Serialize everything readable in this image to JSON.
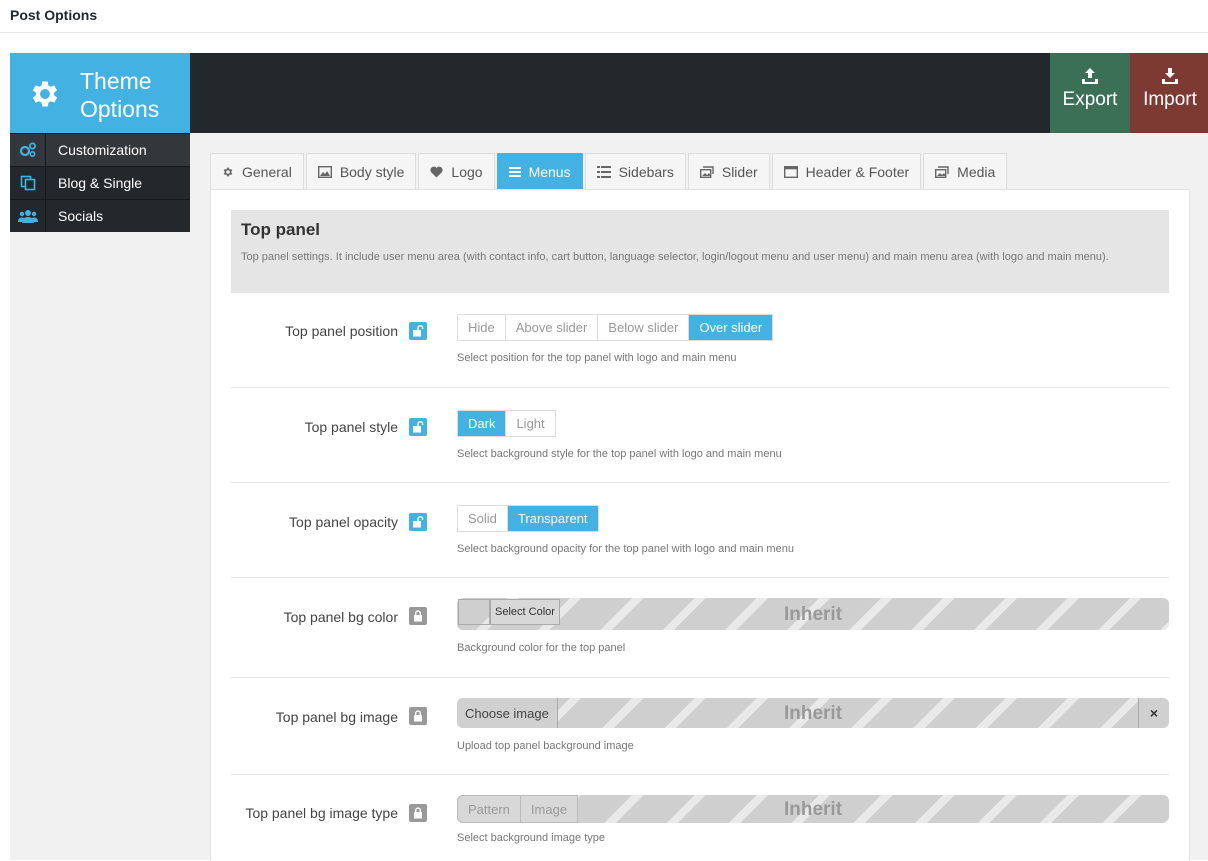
{
  "page": {
    "title": "Post Options"
  },
  "brand": {
    "line1": "Theme",
    "line2": "Options"
  },
  "actions": {
    "export_label": "Export",
    "import_label": "Import"
  },
  "sidebar": {
    "items": [
      {
        "label": "Customization",
        "icon": "cogs-icon",
        "active": true
      },
      {
        "label": "Blog & Single",
        "icon": "copy-icon",
        "active": false
      },
      {
        "label": "Socials",
        "icon": "users-icon",
        "active": false
      }
    ]
  },
  "tabs": [
    {
      "label": "General",
      "icon": "cog-icon"
    },
    {
      "label": "Body style",
      "icon": "image-icon"
    },
    {
      "label": "Logo",
      "icon": "heart-icon"
    },
    {
      "label": "Menus",
      "icon": "menu-icon",
      "active": true
    },
    {
      "label": "Sidebars",
      "icon": "list-icon"
    },
    {
      "label": "Slider",
      "icon": "slides-icon"
    },
    {
      "label": "Header & Footer",
      "icon": "window-icon"
    },
    {
      "label": "Media",
      "icon": "media-icon"
    }
  ],
  "section": {
    "title": "Top panel",
    "description": "Top panel settings. It include user menu area (with contact info, cart button, language selector, login/logout menu and user menu) and main menu area (with logo and main menu)."
  },
  "fields": {
    "position": {
      "label": "Top panel position",
      "options": [
        "Hide",
        "Above slider",
        "Below slider",
        "Over slider"
      ],
      "selected": "Over slider",
      "description": "Select position for the top panel with logo and main menu"
    },
    "style": {
      "label": "Top panel style",
      "options": [
        "Dark",
        "Light"
      ],
      "selected": "Dark",
      "description": "Select background style for the top panel with logo and main menu"
    },
    "opacity": {
      "label": "Top panel opacity",
      "options": [
        "Solid",
        "Transparent"
      ],
      "selected": "Transparent",
      "description": "Select background opacity for the top panel with logo and main menu"
    },
    "bg_color": {
      "label": "Top panel bg color",
      "button": "Select Color",
      "inherit": "Inherit",
      "description": "Background color for the top panel"
    },
    "bg_image": {
      "label": "Top panel bg image",
      "button": "Choose image",
      "clear": "×",
      "inherit": "Inherit",
      "description": "Upload top panel background image"
    },
    "bg_image_type": {
      "label": "Top panel bg image type",
      "options": [
        "Pattern",
        "Image"
      ],
      "inherit": "Inherit",
      "description": "Select background image type"
    }
  },
  "colors": {
    "accent": "#44b1e3",
    "export": "#3b7057",
    "import": "#7d3a32",
    "dark": "#23282d"
  }
}
